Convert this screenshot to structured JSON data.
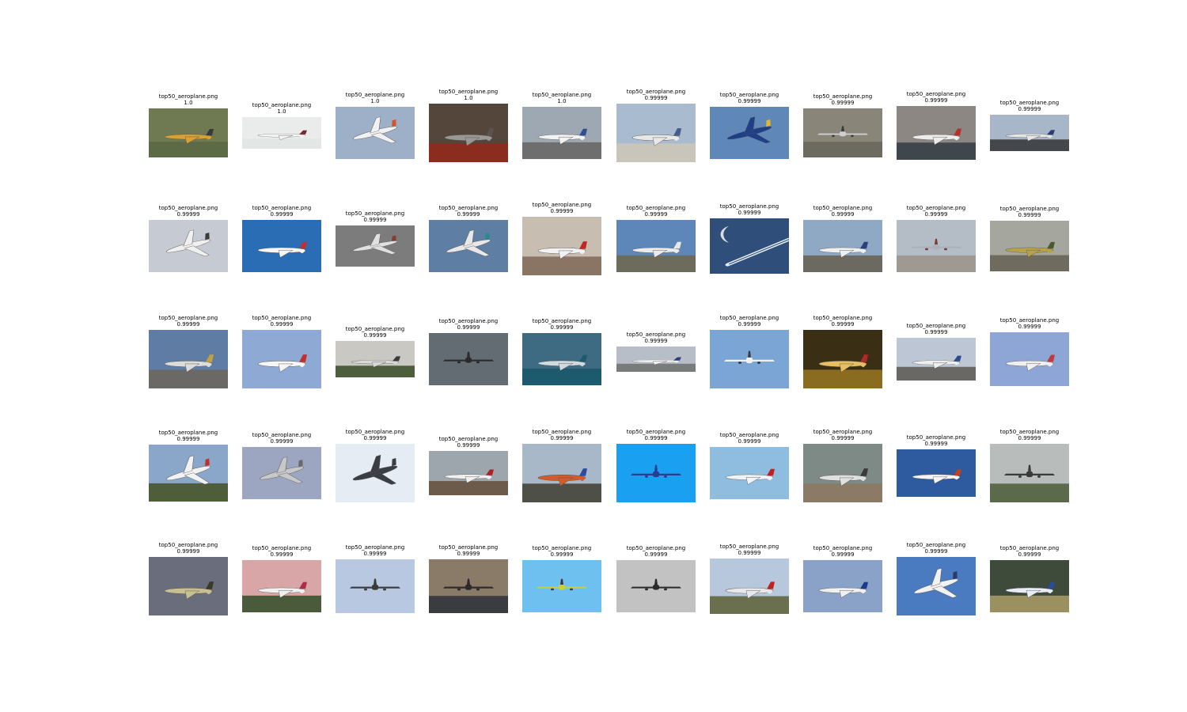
{
  "grid": {
    "rows": [
      [
        {
          "filename": "top50_aeroplane.png",
          "score": "1.0",
          "scene": {
            "sky": "#6f7a52",
            "ground": "#5c6a46",
            "plane": "#d9a032",
            "tail": "#3a3a3a",
            "orient": "side"
          }
        },
        {
          "filename": "top50_aeroplane.png",
          "score": "1.0",
          "scene": {
            "sky": "#e9eceb",
            "ground": "#e2e6e5",
            "plane": "#f4f4f4",
            "tail": "#7b2b36",
            "orient": "side"
          }
        },
        {
          "filename": "top50_aeroplane.png",
          "score": "1.0",
          "scene": {
            "sky": "#9eb0c7",
            "ground": "#9eb0c7",
            "plane": "#f1f1f1",
            "tail": "#d4542a",
            "orient": "diag"
          }
        },
        {
          "filename": "top50_aeroplane.png",
          "score": "1.0",
          "scene": {
            "sky": "#55463c",
            "ground": "#8a2d1e",
            "plane": "#9a9894",
            "tail": "#5a5450",
            "orient": "side"
          }
        },
        {
          "filename": "top50_aeroplane.png",
          "score": "1.0",
          "scene": {
            "sky": "#9ea8b3",
            "ground": "#6e6e6e",
            "plane": "#f2f2f2",
            "tail": "#2e4f8e",
            "orient": "side"
          }
        },
        {
          "filename": "top50_aeroplane.png",
          "score": "0.99999",
          "scene": {
            "sky": "#a9bccf",
            "ground": "#c9c5ba",
            "plane": "#e8e8e8",
            "tail": "#445c88",
            "orient": "side"
          }
        },
        {
          "filename": "top50_aeroplane.png",
          "score": "0.99999",
          "scene": {
            "sky": "#5f88b8",
            "ground": "#5f88b8",
            "plane": "#1f3e8a",
            "tail": "#e3b830",
            "orient": "diag"
          }
        },
        {
          "filename": "top50_aeroplane.png",
          "score": "0.99999",
          "scene": {
            "sky": "#8a8579",
            "ground": "#6d6a5f",
            "plane": "#cfcfcf",
            "tail": "#3a3a3a",
            "orient": "front"
          }
        },
        {
          "filename": "top50_aeroplane.png",
          "score": "0.99999",
          "scene": {
            "sky": "#8c8783",
            "ground": "#40474c",
            "plane": "#ececec",
            "tail": "#b63030",
            "orient": "side"
          }
        },
        {
          "filename": "top50_aeroplane.png",
          "score": "0.99999",
          "scene": {
            "sky": "#a7b7c9",
            "ground": "#44474b",
            "plane": "#e6e6e6",
            "tail": "#2e3d6c",
            "orient": "side"
          }
        }
      ],
      [
        {
          "filename": "top50_aeroplane.png",
          "score": "0.99999",
          "scene": {
            "sky": "#c6cbd3",
            "ground": "#c6cbd3",
            "plane": "#f0f0f0",
            "tail": "#3b3b3b",
            "orient": "diag"
          }
        },
        {
          "filename": "top50_aeroplane.png",
          "score": "0.99999",
          "scene": {
            "sky": "#2a6db5",
            "ground": "#2a6db5",
            "plane": "#f6f6f6",
            "tail": "#c0302f",
            "orient": "side"
          }
        },
        {
          "filename": "top50_aeroplane.png",
          "score": "0.99999",
          "scene": {
            "sky": "#7c7c7c",
            "ground": "#7c7c7c",
            "plane": "#e0e0e0",
            "tail": "#8a3a2e",
            "orient": "diag"
          }
        },
        {
          "filename": "top50_aeroplane.png",
          "score": "0.99999",
          "scene": {
            "sky": "#5e7ea4",
            "ground": "#5e7ea4",
            "plane": "#e8e8e8",
            "tail": "#2a8c8a",
            "orient": "diag"
          }
        },
        {
          "filename": "top50_aeroplane.png",
          "score": "0.99999",
          "scene": {
            "sky": "#c7bdb0",
            "ground": "#8a7564",
            "plane": "#f2f2f2",
            "tail": "#c02828",
            "orient": "side"
          }
        },
        {
          "filename": "top50_aeroplane.png",
          "score": "0.99999",
          "scene": {
            "sky": "#5e87b9",
            "ground": "#6c6b5c",
            "plane": "#ebebeb",
            "tail": "#e8e8e8",
            "orient": "side"
          }
        },
        {
          "filename": "top50_aeroplane.png",
          "score": "0.99999",
          "scene": {
            "sky": "#2f4f7a",
            "ground": "#2f4f7a",
            "plane": "#e8eef5",
            "tail": "#ffffff",
            "orient": "trail"
          }
        },
        {
          "filename": "top50_aeroplane.png",
          "score": "0.99999",
          "scene": {
            "sky": "#8fa9c4",
            "ground": "#6c6a60",
            "plane": "#efefef",
            "tail": "#2a3f7e",
            "orient": "side"
          }
        },
        {
          "filename": "top50_aeroplane.png",
          "score": "0.99999",
          "scene": {
            "sky": "#b4bcc6",
            "ground": "#9e9a92",
            "plane": "#aab0b8",
            "tail": "#7e3a3a",
            "orient": "front"
          }
        },
        {
          "filename": "top50_aeroplane.png",
          "score": "0.99999",
          "scene": {
            "sky": "#a5a79e",
            "ground": "#6f6b5e",
            "plane": "#b6a24a",
            "tail": "#4a5a2e",
            "orient": "side"
          }
        }
      ],
      [
        {
          "filename": "top50_aeroplane.png",
          "score": "0.99999",
          "scene": {
            "sky": "#5f7da4",
            "ground": "#6a6965",
            "plane": "#dcdcdc",
            "tail": "#c0a040",
            "orient": "side"
          }
        },
        {
          "filename": "top50_aeroplane.png",
          "score": "0.99999",
          "scene": {
            "sky": "#8ea9d3",
            "ground": "#8ea9d3",
            "plane": "#f6f6f6",
            "tail": "#c0302f",
            "orient": "side"
          }
        },
        {
          "filename": "top50_aeroplane.png",
          "score": "0.99999",
          "scene": {
            "sky": "#c9c8c3",
            "ground": "#4c5e3c",
            "plane": "#d8d8d8",
            "tail": "#3a3a3a",
            "orient": "side"
          }
        },
        {
          "filename": "top50_aeroplane.png",
          "score": "0.99999",
          "scene": {
            "sky": "#636c72",
            "ground": "#636c72",
            "plane": "#2a2a2a",
            "tail": "#2a2a2a",
            "orient": "front"
          }
        },
        {
          "filename": "top50_aeroplane.png",
          "score": "0.99999",
          "scene": {
            "sky": "#3e6a82",
            "ground": "#1e5a6e",
            "plane": "#d0dbe0",
            "tail": "#1e5a6e",
            "orient": "side"
          }
        },
        {
          "filename": "top50_aeroplane.png",
          "score": "0.99999",
          "scene": {
            "sky": "#b7bec8",
            "ground": "#7a7c7c",
            "plane": "#f0f0f0",
            "tail": "#2a3f7e",
            "orient": "side"
          }
        },
        {
          "filename": "top50_aeroplane.png",
          "score": "0.99999",
          "scene": {
            "sky": "#7aa5d5",
            "ground": "#7aa5d5",
            "plane": "#f2f2f2",
            "tail": "#3a3a3a",
            "orient": "front"
          }
        },
        {
          "filename": "top50_aeroplane.png",
          "score": "0.99999",
          "scene": {
            "sky": "#3a2e14",
            "ground": "#8a6c20",
            "plane": "#e6c060",
            "tail": "#b02a2a",
            "orient": "side"
          }
        },
        {
          "filename": "top50_aeroplane.png",
          "score": "0.99999",
          "scene": {
            "sky": "#bcc6d4",
            "ground": "#6a6864",
            "plane": "#eeeeee",
            "tail": "#2a4c8e",
            "orient": "side"
          }
        },
        {
          "filename": "top50_aeroplane.png",
          "score": "0.99999",
          "scene": {
            "sky": "#8ea6d6",
            "ground": "#8ea6d6",
            "plane": "#f0f0f0",
            "tail": "#c03a3a",
            "orient": "side"
          }
        }
      ],
      [
        {
          "filename": "top50_aeroplane.png",
          "score": "0.99999",
          "scene": {
            "sky": "#8aa6c8",
            "ground": "#4e5e3a",
            "plane": "#f2f2f2",
            "tail": "#c0302f",
            "orient": "diag"
          }
        },
        {
          "filename": "top50_aeroplane.png",
          "score": "0.99999",
          "scene": {
            "sky": "#9da6c0",
            "ground": "#9da6c0",
            "plane": "#c8c8c8",
            "tail": "#6a6a6a",
            "orient": "diag"
          }
        },
        {
          "filename": "top50_aeroplane.png",
          "score": "0.99999",
          "scene": {
            "sky": "#e6ecf4",
            "ground": "#e6ecf4",
            "plane": "#3a3e44",
            "tail": "#3a3e44",
            "orient": "diag"
          }
        },
        {
          "filename": "top50_aeroplane.png",
          "score": "0.99999",
          "scene": {
            "sky": "#9da5ad",
            "ground": "#6c5a4a",
            "plane": "#f0f0f0",
            "tail": "#b02020",
            "orient": "side"
          }
        },
        {
          "filename": "top50_aeroplane.png",
          "score": "0.99999",
          "scene": {
            "sky": "#a8b8c8",
            "ground": "#4e5048",
            "plane": "#d35a2a",
            "tail": "#2a4c9e",
            "orient": "side"
          }
        },
        {
          "filename": "top50_aeroplane.png",
          "score": "0.99999",
          "scene": {
            "sky": "#19a0f0",
            "ground": "#19a0f0",
            "plane": "#2a3e8e",
            "tail": "#2a3e8e",
            "orient": "front"
          }
        },
        {
          "filename": "top50_aeroplane.png",
          "score": "0.99999",
          "scene": {
            "sky": "#8fbde0",
            "ground": "#8fbde0",
            "plane": "#f0f4f8",
            "tail": "#c02020",
            "orient": "side"
          }
        },
        {
          "filename": "top50_aeroplane.png",
          "score": "0.99999",
          "scene": {
            "sky": "#7e8a86",
            "ground": "#8a7a66",
            "plane": "#e0e0e0",
            "tail": "#3a3a3a",
            "orient": "side"
          }
        },
        {
          "filename": "top50_aeroplane.png",
          "score": "0.99999",
          "scene": {
            "sky": "#2e5aa0",
            "ground": "#2e5aa0",
            "plane": "#f4f4f4",
            "tail": "#c04020",
            "orient": "side"
          }
        },
        {
          "filename": "top50_aeroplane.png",
          "score": "0.99999",
          "scene": {
            "sky": "#b8bcba",
            "ground": "#5a6a4a",
            "plane": "#3a3a3a",
            "tail": "#3a3a3a",
            "orient": "front"
          }
        }
      ],
      [
        {
          "filename": "top50_aeroplane.png",
          "score": "0.99999",
          "scene": {
            "sky": "#6a6e7c",
            "ground": "#6a6e7c",
            "plane": "#c8c090",
            "tail": "#3a3a2a",
            "orient": "side"
          }
        },
        {
          "filename": "top50_aeroplane.png",
          "score": "0.99999",
          "scene": {
            "sky": "#d8a6a6",
            "ground": "#4a5a3a",
            "plane": "#f0f0f0",
            "tail": "#b02a4a",
            "orient": "side"
          }
        },
        {
          "filename": "top50_aeroplane.png",
          "score": "0.99999",
          "scene": {
            "sky": "#b8c8e0",
            "ground": "#b8c8e0",
            "plane": "#3a3a3a",
            "tail": "#3a3a3a",
            "orient": "front"
          }
        },
        {
          "filename": "top50_aeroplane.png",
          "score": "0.99999",
          "scene": {
            "sky": "#8a7a68",
            "ground": "#3a3c40",
            "plane": "#2a2a2a",
            "tail": "#2a2a2a",
            "orient": "front"
          }
        },
        {
          "filename": "top50_aeroplane.png",
          "score": "0.99999",
          "scene": {
            "sky": "#6ec0ee",
            "ground": "#6ec0ee",
            "plane": "#c8d040",
            "tail": "#3a3a3a",
            "orient": "front"
          }
        },
        {
          "filename": "top50_aeroplane.png",
          "score": "0.99999",
          "scene": {
            "sky": "#c2c2c2",
            "ground": "#c2c2c2",
            "plane": "#2a2a2a",
            "tail": "#2a2a2a",
            "orient": "front"
          }
        },
        {
          "filename": "top50_aeroplane.png",
          "score": "0.99999",
          "scene": {
            "sky": "#b8c8dc",
            "ground": "#6a704e",
            "plane": "#e8e8e8",
            "tail": "#c02020",
            "orient": "side"
          }
        },
        {
          "filename": "top50_aeroplane.png",
          "score": "0.99999",
          "scene": {
            "sky": "#8aa2c8",
            "ground": "#8aa2c8",
            "plane": "#f0f0f0",
            "tail": "#1e3a8a",
            "orient": "side"
          }
        },
        {
          "filename": "top50_aeroplane.png",
          "score": "0.99999",
          "scene": {
            "sky": "#4a7ac0",
            "ground": "#4a7ac0",
            "plane": "#f2f2f2",
            "tail": "#2a3a6a",
            "orient": "diag"
          }
        },
        {
          "filename": "top50_aeroplane.png",
          "score": "0.99999",
          "scene": {
            "sky": "#3e4a3a",
            "ground": "#9a9060",
            "plane": "#e8ecf4",
            "tail": "#2a4c9e",
            "orient": "side"
          }
        }
      ]
    ]
  }
}
